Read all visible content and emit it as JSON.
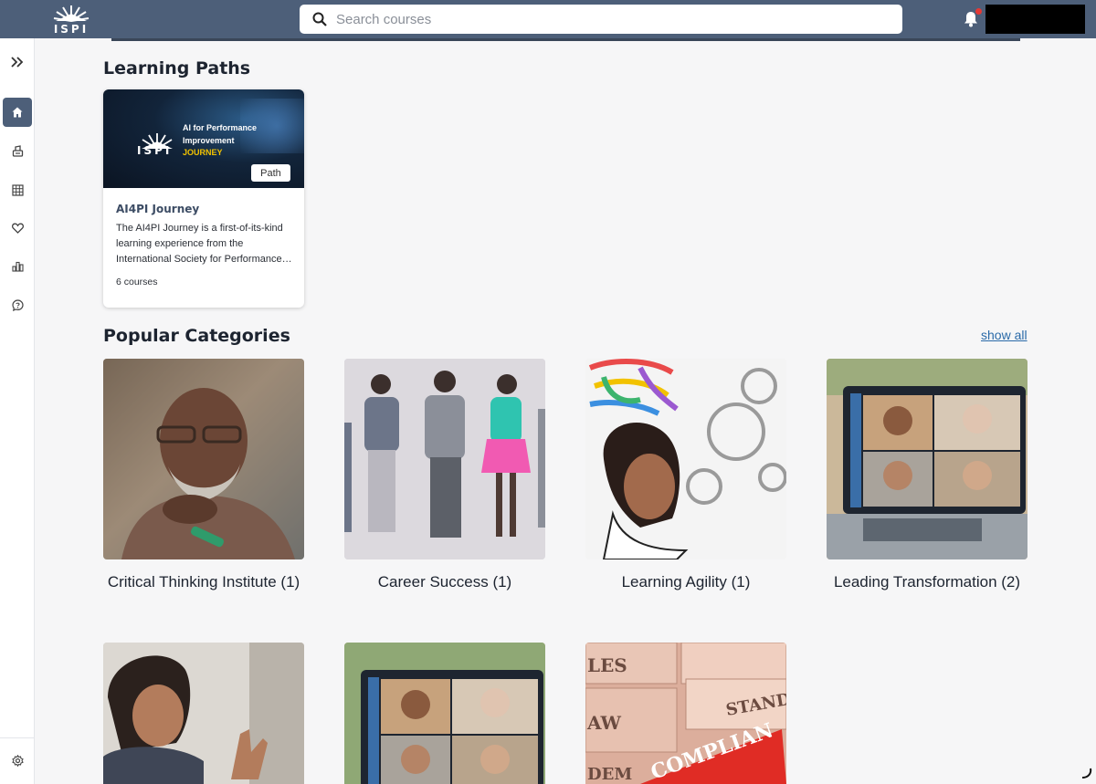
{
  "header": {
    "logo_text": "ISPI",
    "search_placeholder": "Search courses",
    "notification_badge_color": "#e53935"
  },
  "sidebar": {
    "items": [
      {
        "name": "expand",
        "icon": "double-chevron-right-icon"
      },
      {
        "name": "home",
        "icon": "home-icon",
        "active": true
      },
      {
        "name": "catalog",
        "icon": "book-stack-icon"
      },
      {
        "name": "grid",
        "icon": "grid-icon"
      },
      {
        "name": "favorites",
        "icon": "heart-icon"
      },
      {
        "name": "reports",
        "icon": "bar-chart-icon"
      },
      {
        "name": "help",
        "icon": "help-icon"
      },
      {
        "name": "settings",
        "icon": "gear-icon"
      }
    ]
  },
  "learning_paths": {
    "title": "Learning Paths",
    "cards": [
      {
        "image_logo": "ISPI",
        "image_line1": "AI for Performance",
        "image_line2": "Improvement",
        "image_line3": "JOURNEY",
        "badge": "Path",
        "title": "AI4PI Journey",
        "description": "The AI4PI Journey is a first-of-its-kind learning experience from the International Society for Performance…",
        "count": "6 courses"
      }
    ]
  },
  "popular_categories": {
    "title": "Popular Categories",
    "show_all": "show all",
    "items": [
      {
        "name": "Critical Thinking Institute (1)"
      },
      {
        "name": "Career Success (1)"
      },
      {
        "name": "Learning Agility (1)"
      },
      {
        "name": "Leading Transformation (2)"
      },
      {
        "name": ""
      },
      {
        "name": ""
      },
      {
        "name": ""
      }
    ],
    "image_words": {
      "item7_a": "LES",
      "item7_b": "AW",
      "item7_c": "STAND",
      "item7_d": "COMPLIAN",
      "item7_e": "DEM"
    }
  },
  "colors": {
    "header_bg": "#4d5f79",
    "link": "#2a6aa8",
    "accent_yellow": "#f2c200"
  }
}
